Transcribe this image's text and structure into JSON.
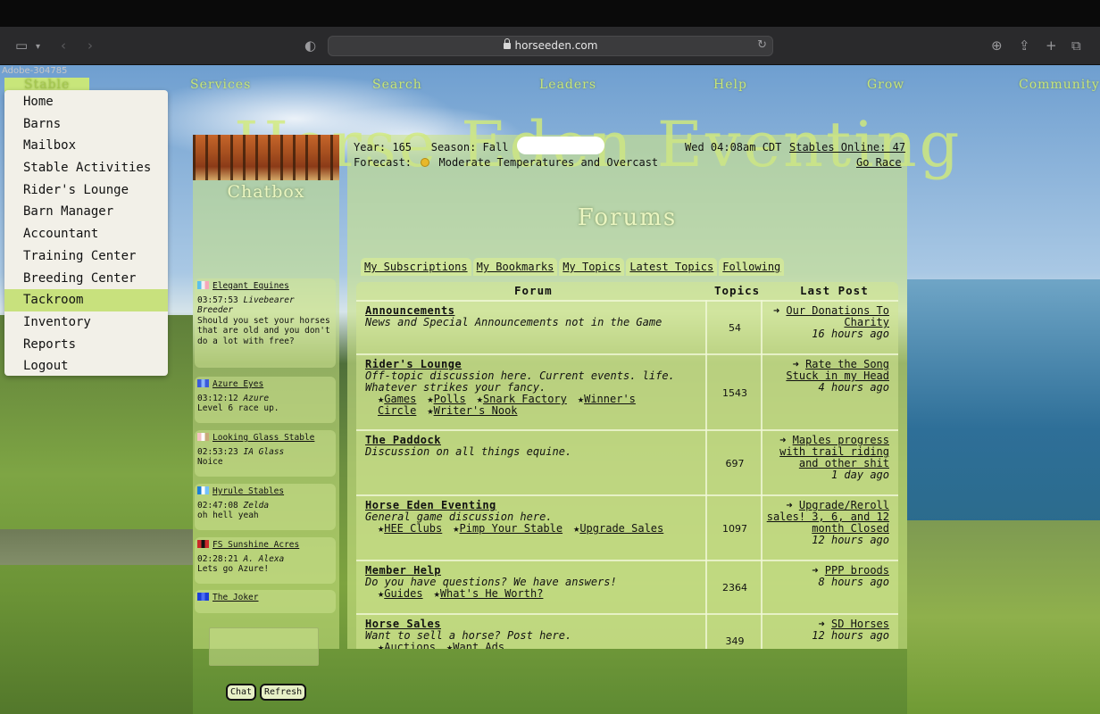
{
  "browser": {
    "url": "horseeden.com",
    "watermark": "Adobe-304785"
  },
  "nav": {
    "items": [
      "Stable",
      "Services",
      "Search",
      "Leaders",
      "Help",
      "Grow",
      "Community"
    ]
  },
  "site_title": "Horse Eden Eventing",
  "stable_menu": {
    "items": [
      "Home",
      "Barns",
      "Mailbox",
      "Stable Activities",
      "Rider's Lounge",
      "Barn Manager",
      "Accountant",
      "Training Center",
      "Breeding Center",
      "Tackroom",
      "Inventory",
      "Reports",
      "Logout"
    ],
    "active": "Tackroom"
  },
  "chatbox": {
    "title": "Chatbox",
    "messages": [
      {
        "stable": "Elegant Equines",
        "time": "03:57:53",
        "user": "Livebearer",
        "role": "Breeder",
        "text": "Should you set your horses that are old and you don't do a lot with free?",
        "flag": [
          "#5bc0eb",
          "#f0f0f0",
          "#f7a8b8"
        ]
      },
      {
        "stable": "Azure Eyes",
        "time": "03:12:12",
        "user": "Azure",
        "role": "",
        "text": "Level 6 race up.",
        "flag": [
          "#3b5bdb",
          "#8ab4f8",
          "#3b5bdb"
        ]
      },
      {
        "stable": "Looking Glass Stable",
        "time": "02:53:23",
        "user": "IA Glass",
        "role": "",
        "text": "Noice",
        "flag": [
          "#f4c2c2",
          "#ffffff",
          "#c9a97a"
        ]
      },
      {
        "stable": "Hyrule Stables",
        "time": "02:47:08",
        "user": "Zelda",
        "role": "",
        "text": "oh hell yeah",
        "flag": [
          "#1c7ed6",
          "#ffffff",
          "#74c0fc"
        ]
      },
      {
        "stable": "FS Sunshine Acres",
        "time": "02:28:21",
        "user": "A. Alexa",
        "role": "",
        "text": "Lets go Azure!",
        "flag": [
          "#c92a2a",
          "#111111",
          "#c92a2a"
        ]
      },
      {
        "stable": "The Joker",
        "time": "",
        "user": "",
        "role": "",
        "text": "",
        "flag": [
          "#1c3fd6",
          "#4c6ef5",
          "#1c3fd6"
        ]
      }
    ],
    "chat_button": "Chat",
    "refresh_button": "Refresh"
  },
  "status": {
    "year_label": "Year:",
    "year": "165",
    "season_label": "Season:",
    "season": "Fall",
    "datetime": "Wed 04:08am CDT",
    "stables_online": "Stables Online: 47",
    "forecast_label": "Forecast:",
    "forecast": "Moderate Temperatures and Overcast",
    "go_race": "Go Race"
  },
  "forums": {
    "title": "Forums",
    "tabs": [
      "My Subscriptions",
      "My Bookmarks",
      "My Topics",
      "Latest Topics",
      "Following"
    ],
    "headers": {
      "forum": "Forum",
      "topics": "Topics",
      "last_post": "Last Post"
    },
    "rows": [
      {
        "name": "Announcements",
        "desc": "News and Special Announcements not in the Game",
        "subs": [],
        "topics": "54",
        "last_post": "Our Donations To Charity",
        "ago": "16 hours ago"
      },
      {
        "name": "Rider's Lounge",
        "desc": "Off-topic discussion here. Current events. life. Whatever strikes your fancy.",
        "subs": [
          "Games",
          "Polls",
          "Snark Factory",
          "Winner's Circle",
          "Writer's Nook"
        ],
        "topics": "1543",
        "last_post": "Rate the Song Stuck in my Head",
        "ago": "4 hours ago"
      },
      {
        "name": "The Paddock",
        "desc": "Discussion on all things equine.",
        "subs": [],
        "topics": "697",
        "last_post": "Maples progress with trail riding and other shit",
        "ago": "1 day ago"
      },
      {
        "name": "Horse Eden Eventing",
        "desc": "General game discussion here.",
        "subs": [
          "HEE Clubs",
          "Pimp Your Stable",
          "Upgrade Sales"
        ],
        "topics": "1097",
        "last_post": "Upgrade/Reroll sales! 3, 6, and 12 month Closed",
        "ago": "12 hours ago"
      },
      {
        "name": "Member Help",
        "desc": "Do you have questions? We have answers!",
        "subs": [
          "Guides",
          "What's He Worth?"
        ],
        "topics": "2364",
        "last_post": "PPP broods",
        "ago": "8 hours ago"
      },
      {
        "name": "Horse Sales",
        "desc": "Want to sell a horse? Post here.",
        "subs": [
          "Auctions",
          "Want Ads"
        ],
        "topics": "349",
        "last_post": "SD Horses",
        "ago": "12 hours ago"
      }
    ]
  }
}
